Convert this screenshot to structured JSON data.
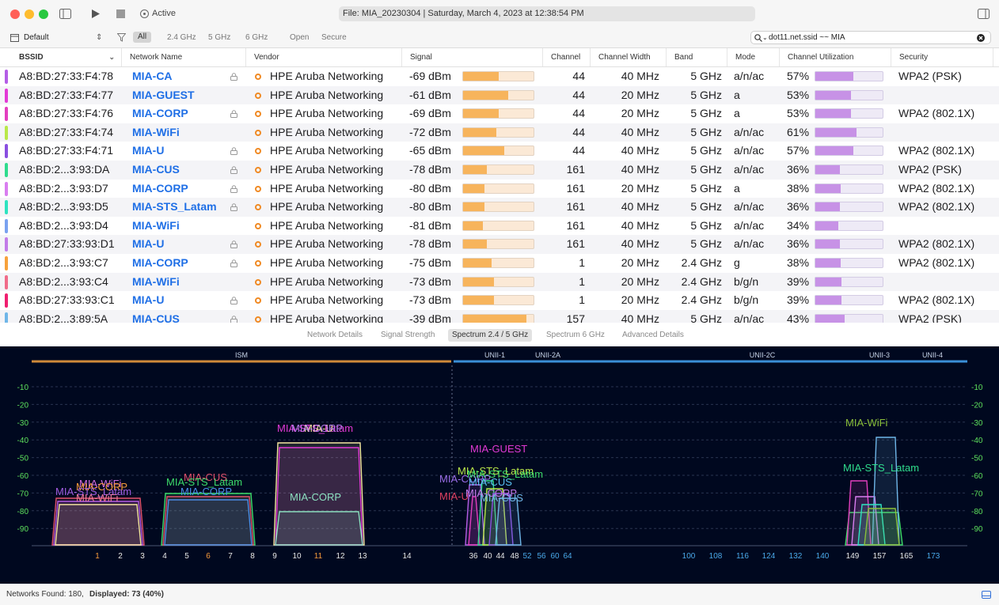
{
  "titlebar": {
    "status_label": "Active",
    "file_label": "File: MIA_20230304 | Saturday, March 4, 2023 at 12:38:54 PM"
  },
  "toolbar": {
    "profile": "Default",
    "filters": [
      "All",
      "2.4 GHz",
      "5 GHz",
      "6 GHz",
      "Open",
      "Secure"
    ],
    "search_value": "dot11.net.ssid ~~ MIA"
  },
  "table": {
    "columns": [
      "BSSID",
      "Network Name",
      "Vendor",
      "Signal",
      "Channel",
      "Channel Width",
      "Band",
      "Mode",
      "Channel Utilization",
      "Security"
    ],
    "rows": [
      {
        "color": "#b45ee6",
        "bssid": "A8:BD:27:33:F4:78",
        "ssid": "MIA-CA",
        "lock": true,
        "vendor": "HPE Aruba Networking",
        "signal": "-69 dBm",
        "signal_pct": 0.51,
        "channel": "44",
        "width": "40 MHz",
        "band": "5 GHz",
        "mode": "a/n/ac",
        "util": "57%",
        "util_pct": 0.57,
        "security": "WPA2 (PSK)"
      },
      {
        "color": "#e23ad6",
        "bssid": "A8:BD:27:33:F4:77",
        "ssid": "MIA-GUEST",
        "lock": false,
        "vendor": "HPE Aruba Networking",
        "signal": "-61 dBm",
        "signal_pct": 0.64,
        "channel": "44",
        "width": "20 MHz",
        "band": "5 GHz",
        "mode": "a",
        "util": "53%",
        "util_pct": 0.53,
        "security": ""
      },
      {
        "color": "#e33fbf",
        "bssid": "A8:BD:27:33:F4:76",
        "ssid": "MIA-CORP",
        "lock": true,
        "vendor": "HPE Aruba Networking",
        "signal": "-69 dBm",
        "signal_pct": 0.51,
        "channel": "44",
        "width": "20 MHz",
        "band": "5 GHz",
        "mode": "a",
        "util": "53%",
        "util_pct": 0.53,
        "security": "WPA2 (802.1X)"
      },
      {
        "color": "#b9e84a",
        "bssid": "A8:BD:27:33:F4:74",
        "ssid": "MIA-WiFi",
        "lock": false,
        "vendor": "HPE Aruba Networking",
        "signal": "-72 dBm",
        "signal_pct": 0.47,
        "channel": "44",
        "width": "40 MHz",
        "band": "5 GHz",
        "mode": "a/n/ac",
        "util": "61%",
        "util_pct": 0.61,
        "security": ""
      },
      {
        "color": "#8a4fe0",
        "bssid": "A8:BD:27:33:F4:71",
        "ssid": "MIA-U",
        "lock": true,
        "vendor": "HPE Aruba Networking",
        "signal": "-65 dBm",
        "signal_pct": 0.58,
        "channel": "44",
        "width": "40 MHz",
        "band": "5 GHz",
        "mode": "a/n/ac",
        "util": "57%",
        "util_pct": 0.57,
        "security": "WPA2 (802.1X)"
      },
      {
        "color": "#2fdc8e",
        "bssid": "A8:BD:2...3:93:DA",
        "ssid": "MIA-CUS",
        "lock": true,
        "vendor": "HPE Aruba Networking",
        "signal": "-78 dBm",
        "signal_pct": 0.34,
        "channel": "161",
        "width": "40 MHz",
        "band": "5 GHz",
        "mode": "a/n/ac",
        "util": "36%",
        "util_pct": 0.36,
        "security": "WPA2 (PSK)"
      },
      {
        "color": "#d97ef0",
        "bssid": "A8:BD:2...3:93:D7",
        "ssid": "MIA-CORP",
        "lock": true,
        "vendor": "HPE Aruba Networking",
        "signal": "-80 dBm",
        "signal_pct": 0.3,
        "channel": "161",
        "width": "20 MHz",
        "band": "5 GHz",
        "mode": "a",
        "util": "38%",
        "util_pct": 0.38,
        "security": "WPA2 (802.1X)"
      },
      {
        "color": "#2ee3c0",
        "bssid": "A8:BD:2...3:93:D5",
        "ssid": "MIA-STS_Latam",
        "lock": true,
        "vendor": "HPE Aruba Networking",
        "signal": "-80 dBm",
        "signal_pct": 0.3,
        "channel": "161",
        "width": "40 MHz",
        "band": "5 GHz",
        "mode": "a/n/ac",
        "util": "36%",
        "util_pct": 0.36,
        "security": "WPA2 (802.1X)"
      },
      {
        "color": "#7aa2f0",
        "bssid": "A8:BD:2...3:93:D4",
        "ssid": "MIA-WiFi",
        "lock": false,
        "vendor": "HPE Aruba Networking",
        "signal": "-81 dBm",
        "signal_pct": 0.28,
        "channel": "161",
        "width": "40 MHz",
        "band": "5 GHz",
        "mode": "a/n/ac",
        "util": "34%",
        "util_pct": 0.34,
        "security": ""
      },
      {
        "color": "#c27be8",
        "bssid": "A8:BD:27:33:93:D1",
        "ssid": "MIA-U",
        "lock": true,
        "vendor": "HPE Aruba Networking",
        "signal": "-78 dBm",
        "signal_pct": 0.34,
        "channel": "161",
        "width": "40 MHz",
        "band": "5 GHz",
        "mode": "a/n/ac",
        "util": "36%",
        "util_pct": 0.36,
        "security": "WPA2 (802.1X)"
      },
      {
        "color": "#f7a23c",
        "bssid": "A8:BD:2...3:93:C7",
        "ssid": "MIA-CORP",
        "lock": true,
        "vendor": "HPE Aruba Networking",
        "signal": "-75 dBm",
        "signal_pct": 0.4,
        "channel": "1",
        "width": "20 MHz",
        "band": "2.4 GHz",
        "mode": "g",
        "util": "38%",
        "util_pct": 0.38,
        "security": "WPA2 (802.1X)"
      },
      {
        "color": "#f06c8a",
        "bssid": "A8:BD:2...3:93:C4",
        "ssid": "MIA-WiFi",
        "lock": false,
        "vendor": "HPE Aruba Networking",
        "signal": "-73 dBm",
        "signal_pct": 0.44,
        "channel": "1",
        "width": "20 MHz",
        "band": "2.4 GHz",
        "mode": "b/g/n",
        "util": "39%",
        "util_pct": 0.39,
        "security": ""
      },
      {
        "color": "#f02070",
        "bssid": "A8:BD:27:33:93:C1",
        "ssid": "MIA-U",
        "lock": true,
        "vendor": "HPE Aruba Networking",
        "signal": "-73 dBm",
        "signal_pct": 0.44,
        "channel": "1",
        "width": "20 MHz",
        "band": "2.4 GHz",
        "mode": "b/g/n",
        "util": "39%",
        "util_pct": 0.39,
        "security": "WPA2 (802.1X)"
      },
      {
        "color": "#6fb6e8",
        "bssid": "A8:BD:2...3:89:5A",
        "ssid": "MIA-CUS",
        "lock": true,
        "vendor": "HPE Aruba Networking",
        "signal": "-39 dBm",
        "signal_pct": 0.9,
        "channel": "157",
        "width": "40 MHz",
        "band": "5 GHz",
        "mode": "a/n/ac",
        "util": "43%",
        "util_pct": 0.43,
        "security": "WPA2 (PSK)"
      }
    ]
  },
  "detail_tabs": [
    "Network Details",
    "Signal Strength",
    "Spectrum 2.4 / 5 GHz",
    "Spectrum 6 GHz",
    "Advanced Details"
  ],
  "spectrum": {
    "bands": [
      "ISM",
      "UNII-1",
      "UNII-2A",
      "UNII-2C",
      "UNII-3",
      "UNII-4"
    ],
    "y_ticks": [
      "-10",
      "-20",
      "-30",
      "-40",
      "-50",
      "-60",
      "-70",
      "-80",
      "-90"
    ],
    "channels_24": [
      "1",
      "2",
      "3",
      "4",
      "5",
      "6",
      "7",
      "8",
      "9",
      "10",
      "11",
      "12",
      "13",
      "14"
    ],
    "channels_5": [
      "36",
      "40",
      "44",
      "48",
      "52",
      "56",
      "60",
      "64",
      "100",
      "108",
      "116",
      "124",
      "132",
      "140",
      "149",
      "157",
      "165",
      "173"
    ],
    "labels": [
      {
        "text": "MIA-WiFi",
        "color": "#d36be0"
      },
      {
        "text": "MIA-CORP",
        "color": "#f59a3a"
      },
      {
        "text": "MIA-STS_Latam",
        "color": "#a05ce0"
      },
      {
        "text": "MIA-WiFi",
        "color": "#f07a9a"
      },
      {
        "text": "MIA-CUS",
        "color": "#e0506a"
      },
      {
        "text": "MIA-STS_Latam",
        "color": "#3ddc6a"
      },
      {
        "text": "MIA-CORP",
        "color": "#4b8ee8"
      },
      {
        "text": "MIA-STS_Latam",
        "color": "#e23ad6"
      },
      {
        "text": "MIA-U",
        "color": "#f5e6a0"
      },
      {
        "text": "MIA-CORP",
        "color": "#b57ae8"
      },
      {
        "text": "MIA-CORP",
        "color": "#8ce0c0"
      },
      {
        "text": "MIA-GUEST",
        "color": "#e23ad6"
      },
      {
        "text": "MIA-STS_Latam",
        "color": "#b9e84a"
      },
      {
        "text": "MIA-CORP",
        "color": "#9b6ee8"
      },
      {
        "text": "MIA-CUS",
        "color": "#5ac0f0"
      },
      {
        "text": "MIA-U",
        "color": "#e04060"
      },
      {
        "text": "MIA-STS_Latam",
        "color": "#3ddc6a"
      },
      {
        "text": "MIA-CUS",
        "color": "#6fb6e8"
      },
      {
        "text": "MIA-CORP",
        "color": "#c07ae8"
      },
      {
        "text": "MIA-WiFi",
        "color": "#8ac03a"
      },
      {
        "text": "MIA-STS_Latam",
        "color": "#2fdc8e"
      }
    ]
  },
  "statusbar": {
    "prefix": "Networks Found: 180, ",
    "displayed": "Displayed: 73 (40%)"
  }
}
